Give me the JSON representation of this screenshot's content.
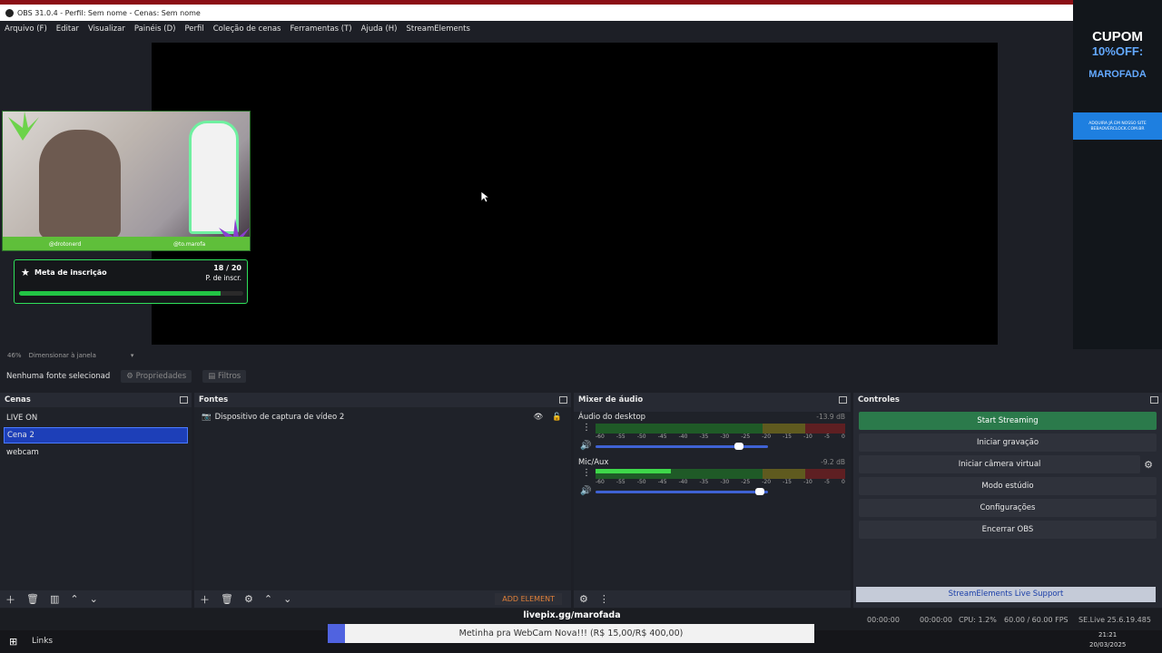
{
  "window": {
    "title": "OBS 31.0.4 - Perfil: Sem nome - Cenas: Sem nome"
  },
  "menu": [
    "Arquivo (F)",
    "Editar",
    "Visualizar",
    "Painéis (D)",
    "Perfil",
    "Coleção de cenas",
    "Ferramentas (T)",
    "Ajuda (H)",
    "StreamElements"
  ],
  "overlay": {
    "goal_title": "Meta de inscrição",
    "goal_count": "18 / 20",
    "goal_sub": "P. de inscr.",
    "goal_progress": 0.9,
    "webcam_handles": [
      "@drotonerd",
      "@to.marofa"
    ]
  },
  "promo": {
    "line1": "CUPOM",
    "line2": "10%OFF:",
    "code": "MAROFADA",
    "small1": "ADQUIRA JÁ EM NOSSO SITE",
    "small2": "BEBAOVERCLOCK.COM.BR"
  },
  "zoom": {
    "percent": "46%",
    "mode": "Dimensionar à janela"
  },
  "propbar": {
    "no_source": "Nenhuma fonte selecionad",
    "properties": "Propriedades",
    "filters": "Filtros"
  },
  "scenes": {
    "title": "Cenas",
    "items": [
      "LIVE ON",
      "Cena 2",
      "webcam"
    ],
    "selected": 1
  },
  "sources": {
    "title": "Fontes",
    "items": [
      "Dispositivo de captura de vídeo 2"
    ],
    "add_element": "ADD ELEMENT"
  },
  "mixer": {
    "title": "Mixer de áudio",
    "ticks": [
      "-60",
      "-55",
      "-50",
      "-45",
      "-40",
      "-35",
      "-30",
      "-25",
      "-20",
      "-15",
      "-10",
      "-5",
      "0"
    ],
    "channels": [
      {
        "name": "Áudio do desktop",
        "db": "-13.9 dB",
        "level": 0.0,
        "volume": 0.83
      },
      {
        "name": "Mic/Aux",
        "db": "-9.2 dB",
        "level": 0.3,
        "volume": 0.95
      }
    ]
  },
  "controls": {
    "title": "Controles",
    "buttons": [
      "Start Streaming",
      "Iniciar gravação",
      "Iniciar câmera virtual",
      "Modo estúdio",
      "Configurações",
      "Encerrar OBS"
    ],
    "support": "StreamElements Live Support"
  },
  "status": {
    "rec_time": "00:00:00",
    "stream_time": "00:00:00",
    "cpu": "CPU: 1.2%",
    "fps": "60.00 / 60.00 FPS",
    "version": "SE.Live 25.6.19.485"
  },
  "overlay_bottom": {
    "livepix": "livepix.gg/marofada",
    "donation": "Metinha pra WebCam Nova!!! (R$ 15,00/R$ 400,00)"
  },
  "taskbar": {
    "links": "Links",
    "time": "21:21",
    "date": "20/03/2025"
  }
}
